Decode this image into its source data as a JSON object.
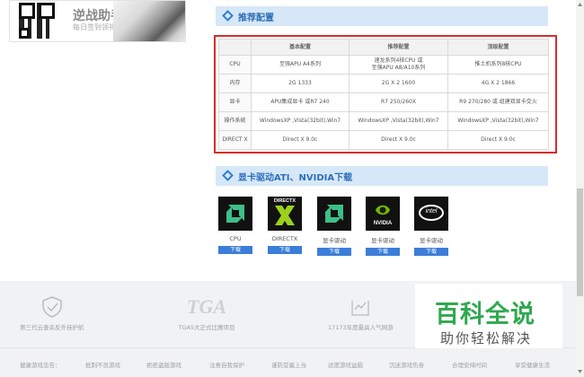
{
  "app_card": {
    "title": "逆战助手APP",
    "subtitle": "每日签到领礼包"
  },
  "recommend": {
    "header": "推荐配置",
    "columns": [
      "",
      "基本配置",
      "推荐配置",
      "顶级配置"
    ],
    "rows": [
      {
        "label": "CPU",
        "basic": "至强APU A4系列",
        "recommended": "速龙系列4核CPU 或\n至强APU A8/A10系列",
        "top": "推土机系列8核CPU"
      },
      {
        "label": "内存",
        "basic": "2G 1333",
        "recommended": "2G X 2 1600",
        "top": "4G X 2 1866"
      },
      {
        "label": "显卡",
        "basic": "APU集成显卡 或R7 240",
        "recommended": "R7 250/260X",
        "top": "R9 270/280 或 组建双显卡交火"
      },
      {
        "label": "操作系统",
        "basic": "WindowsXP ,Vista(32bit),Win7",
        "recommended": "WindowsXP ,Vista(32bit),Win7",
        "top": "WindowsXP ,Vista(32bit),Win7"
      },
      {
        "label": "DIRECT X",
        "basic": "Direct X 9.0c",
        "recommended": "Direct X 9.0c",
        "top": "Direct X 9.0c"
      }
    ]
  },
  "drivers": {
    "header": "显卡驱动ATI、NVIDIA下载",
    "download_label": "下载",
    "items": [
      {
        "name": "CPU",
        "icon": "amd-logo-icon"
      },
      {
        "name": "DIRECTX",
        "icon": "directx-logo-icon",
        "badge": "DIRECTX"
      },
      {
        "name": "显卡驱动",
        "icon": "amd-logo-icon"
      },
      {
        "name": "显卡驱动",
        "icon": "nvidia-logo-icon",
        "badge": "NVIDIA"
      },
      {
        "name": "显卡驱动",
        "icon": "intel-logo-icon",
        "badge": "intel"
      }
    ]
  },
  "footer": {
    "features": [
      {
        "label": "第三代云查杀反外挂护航",
        "icon": "shield-check-icon"
      },
      {
        "label": "TGA5大正式比赛项目",
        "icon": "tga-logo-icon",
        "logo_text": "TGA"
      },
      {
        "label": "17173年度最具人气网游",
        "icon": "trophy-icon"
      }
    ],
    "links": [
      "健康游戏忠告：",
      "抵制不良游戏",
      "拒绝盗版游戏",
      "注意自我保护",
      "谨防受骗上当",
      "适度游戏益脑",
      "沉迷游戏伤身",
      "合理安排时间",
      "享受健康生活"
    ]
  },
  "watermark": {
    "main": "百科全说",
    "sub": "助你轻松解决"
  },
  "colors": {
    "accent": "#2f7fd0",
    "download": "#3b7dd8",
    "highlight_frame": "#d92b2b",
    "watermark_green": "#2fa84f"
  }
}
